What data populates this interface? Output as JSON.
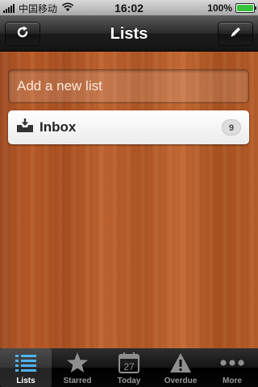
{
  "status_bar": {
    "carrier": "中国移动",
    "time": "16:02",
    "battery": "100%",
    "battery_level": 1.0,
    "wifi_icon": "wifi-icon",
    "signal_icon": "signal-icon",
    "battery_icon": "battery-icon"
  },
  "nav": {
    "title": "Lists",
    "left_icon": "refresh-icon",
    "right_icon": "pencil-icon"
  },
  "new_list": {
    "placeholder": "Add a new list"
  },
  "lists": [
    {
      "label": "Inbox",
      "count": "9",
      "icon": "inbox-tray-icon"
    }
  ],
  "tabs": [
    {
      "label": "Lists",
      "icon": "list-icon",
      "active": true
    },
    {
      "label": "Starred",
      "icon": "star-icon",
      "active": false
    },
    {
      "label": "Today",
      "icon": "calendar-icon",
      "date": "27",
      "active": false
    },
    {
      "label": "Overdue",
      "icon": "warning-icon",
      "active": false
    },
    {
      "label": "More",
      "icon": "more-dots-icon",
      "active": false
    }
  ],
  "colors": {
    "wood": "#b35a28",
    "battery_green": "#35c23c",
    "active_tab_icon": "#4fb3f0"
  }
}
